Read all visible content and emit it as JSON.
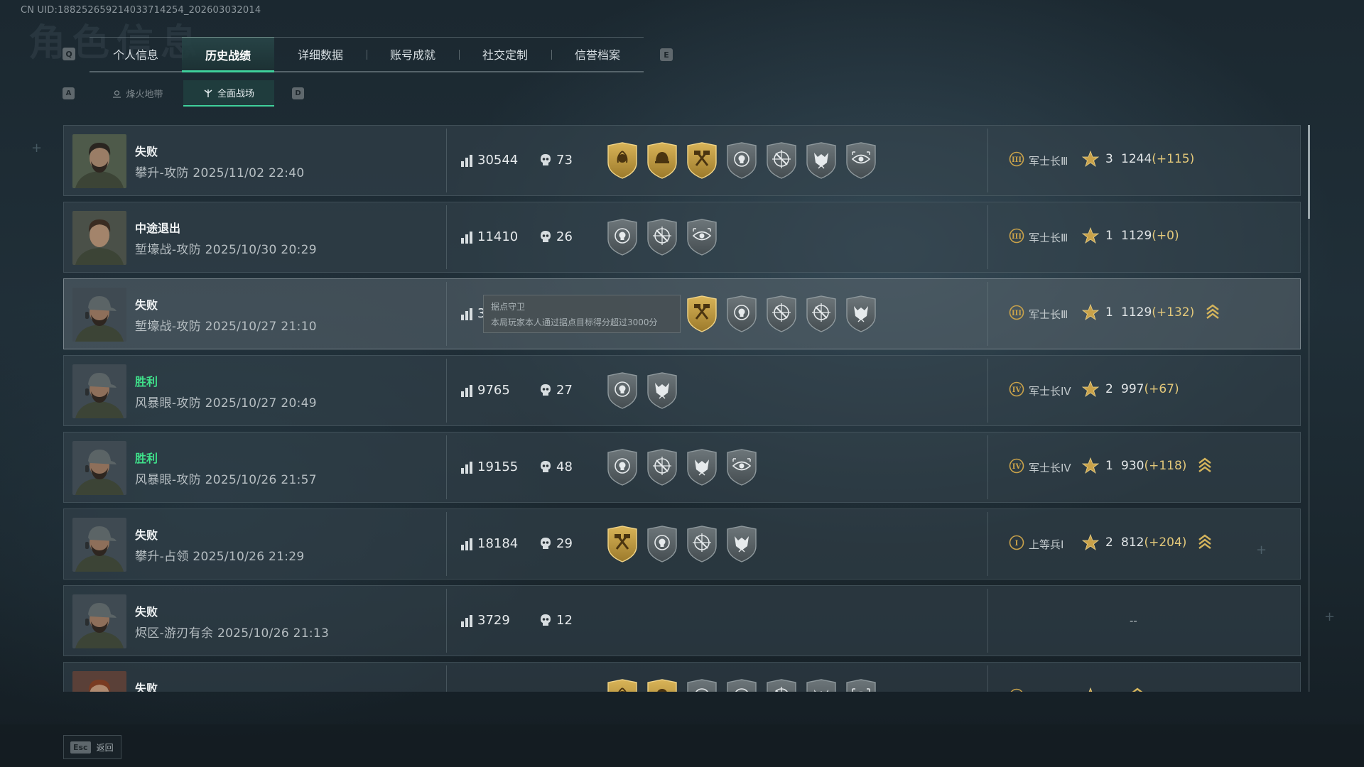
{
  "uid_text": "CN UID:1882526592140337142​54_202603032014",
  "ghost_title": "角色信息",
  "keys": {
    "left_tab": "Q",
    "right_tab": "E",
    "left_sub": "A",
    "right_sub": "D",
    "esc": "Esc"
  },
  "tabs": [
    "个人信息",
    "历史战绩",
    "详细数据",
    "账号成就",
    "社交定制",
    "信誉档案"
  ],
  "active_tab": "历史战绩",
  "subtabs": [
    "烽火地带",
    "全面战场"
  ],
  "active_subtab": "全面战场",
  "rows": [
    {
      "result": "失败",
      "win": false,
      "mode": "攀升-攻防",
      "time": "2025/11/02 22:40",
      "score": "30544",
      "kills": "73",
      "medals": [
        "gold-laurel",
        "gold-helmet",
        "gold-hammers",
        "silver-skull",
        "silver-crosshair",
        "silver-wolf",
        "silver-eye"
      ],
      "rank_numeral": "III",
      "rank": "军士长Ⅲ",
      "stars": "3",
      "rating": "1244",
      "delta": "(+115)",
      "promotion": false
    },
    {
      "result": "中途退出",
      "win": false,
      "mode": "堑壕战-攻防",
      "time": "2025/10/30 20:29",
      "score": "11410",
      "kills": "26",
      "medals": [
        "silver-skull",
        "silver-crosshair",
        "silver-eye"
      ],
      "rank_numeral": "III",
      "rank": "军士长Ⅲ",
      "stars": "1",
      "rating": "1129",
      "delta": "(+0)",
      "promotion": false
    },
    {
      "result": "失败",
      "win": false,
      "mode": "堑壕战-攻防",
      "time": "2025/10/27 21:10",
      "score": "3",
      "kills": "",
      "medals": [
        "gold-hammers",
        "silver-skull",
        "silver-crosshair",
        "silver-crosshair",
        "silver-wolf"
      ],
      "rank_numeral": "III",
      "rank": "军士长Ⅲ",
      "stars": "1",
      "rating": "1129",
      "delta": "(+132)",
      "promotion": true,
      "tooltip": {
        "title": "据点守卫",
        "body": "本局玩家本人通过据点目标得分超过3000分"
      }
    },
    {
      "result": "胜利",
      "win": true,
      "mode": "风暴眼-攻防",
      "time": "2025/10/27 20:49",
      "score": "9765",
      "kills": "27",
      "medals": [
        "silver-skull",
        "silver-wolf"
      ],
      "rank_numeral": "IV",
      "rank": "军士长IV",
      "stars": "2",
      "rating": "997",
      "delta": "(+67)",
      "promotion": false
    },
    {
      "result": "胜利",
      "win": true,
      "mode": "风暴眼-攻防",
      "time": "2025/10/26 21:57",
      "score": "19155",
      "kills": "48",
      "medals": [
        "silver-skull",
        "silver-crosshair",
        "silver-wolf",
        "silver-eye"
      ],
      "rank_numeral": "IV",
      "rank": "军士长IV",
      "stars": "1",
      "rating": "930",
      "delta": "(+118)",
      "promotion": true
    },
    {
      "result": "失败",
      "win": false,
      "mode": "攀升-占领",
      "time": "2025/10/26 21:29",
      "score": "18184",
      "kills": "29",
      "medals": [
        "gold-hammers",
        "silver-skull",
        "silver-crosshair",
        "silver-wolf"
      ],
      "rank_numeral": "I",
      "rank": "上等兵Ⅰ",
      "stars": "2",
      "rating": "812",
      "delta": "(+204)",
      "promotion": true
    },
    {
      "result": "失败",
      "win": false,
      "mode": "烬区-游刃有余",
      "time": "2025/10/26 21:13",
      "score": "3729",
      "kills": "12",
      "medals": [],
      "no_rank": "--"
    },
    {
      "result": "失败",
      "win": false,
      "mode": "",
      "time": "",
      "score": "",
      "kills": "",
      "medals": [
        "gold-laurel",
        "gold-helmet",
        "silver-skull",
        "silver-skull",
        "silver-crosshair",
        "silver-wolf",
        "silver-eye"
      ],
      "rank_numeral": "I",
      "rank": "",
      "stars": "",
      "rating": "",
      "delta": "",
      "promotion": true
    }
  ],
  "footer": {
    "back_label": "返回"
  },
  "colors": {
    "accent": "#3fcf9b",
    "win": "#3fe08a",
    "gold": "#c9a24a",
    "delta": "#e3c87a"
  }
}
